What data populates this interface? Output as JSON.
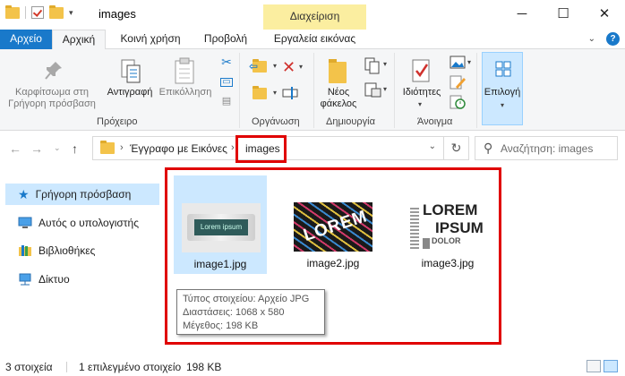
{
  "window": {
    "title": "images",
    "contextual_tab": "Διαχείριση"
  },
  "ribbon_tabs": {
    "file": "Αρχείο",
    "home": "Αρχική",
    "share": "Κοινή χρήση",
    "view": "Προβολή",
    "picture_tools": "Εργαλεία εικόνας"
  },
  "ribbon": {
    "clipboard": {
      "pin_line1": "Καρφίτσωμα στη",
      "pin_line2": "Γρήγορη πρόσβαση",
      "copy": "Αντιγραφή",
      "paste": "Επικόλληση",
      "group": "Πρόχειρο"
    },
    "organize": {
      "group": "Οργάνωση"
    },
    "new": {
      "folder_line1": "Νέος",
      "folder_line2": "φάκελος",
      "group": "Δημιουργία"
    },
    "open": {
      "properties": "Ιδιότητες",
      "group": "Άνοιγμα"
    },
    "select": {
      "label": "Επιλογή"
    }
  },
  "address": {
    "crumbs": [
      "Έγγραφο με Εικόνες",
      "images"
    ]
  },
  "search": {
    "placeholder": "Αναζήτηση: images"
  },
  "nav": {
    "items": [
      {
        "label": "Γρήγορη πρόσβαση"
      },
      {
        "label": "Αυτός ο υπολογιστής"
      },
      {
        "label": "Βιβλιοθήκες"
      },
      {
        "label": "Δίκτυο"
      }
    ]
  },
  "files": [
    {
      "name": "image1.jpg"
    },
    {
      "name": "image2.jpg"
    },
    {
      "name": "image3.jpg"
    }
  ],
  "tooltip": {
    "type": "Τύπος στοιχείου: Αρχείο JPG",
    "dimensions": "Διαστάσεις: 1068 x 580",
    "size": "Μέγεθος: 198 KB"
  },
  "status": {
    "count": "3 στοιχεία",
    "selected": "1 επιλεγμένο στοιχείο",
    "selected_size": "198 KB"
  },
  "thumb_text": {
    "img1": "Lorem ipsum",
    "img2": "LOREM",
    "img3_top": "LOREM",
    "img3_bottom": "IPSUM",
    "img3_side": "DOLOR"
  },
  "colors": {
    "accent": "#1979ca",
    "selection": "#cce8ff",
    "highlight": "#e00000",
    "context_tab": "#fbeea0"
  }
}
